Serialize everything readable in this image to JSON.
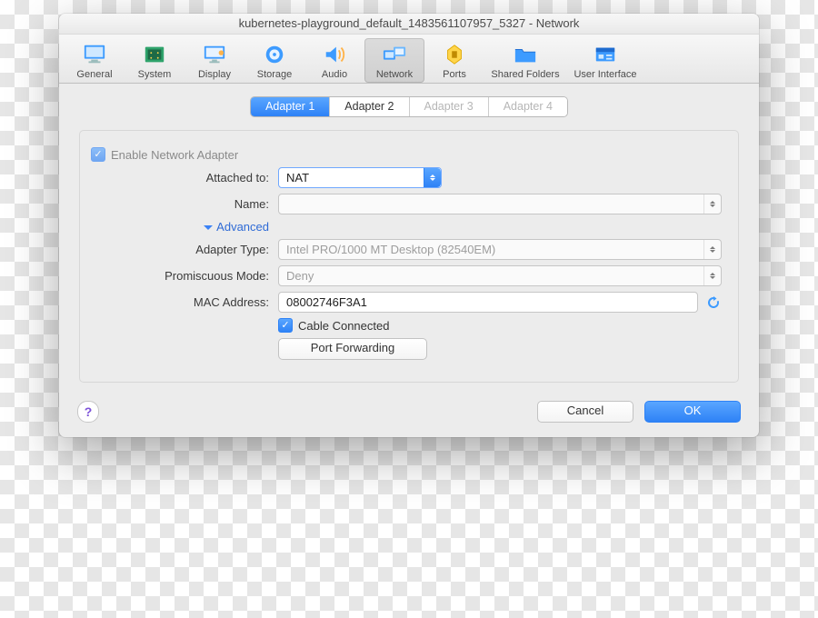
{
  "window": {
    "title": "kubernetes-playground_default_1483561107957_5327 - Network"
  },
  "toolbar": {
    "items": [
      {
        "id": "general",
        "label": "General"
      },
      {
        "id": "system",
        "label": "System"
      },
      {
        "id": "display",
        "label": "Display"
      },
      {
        "id": "storage",
        "label": "Storage"
      },
      {
        "id": "audio",
        "label": "Audio"
      },
      {
        "id": "network",
        "label": "Network"
      },
      {
        "id": "ports",
        "label": "Ports"
      },
      {
        "id": "shared",
        "label": "Shared Folders"
      },
      {
        "id": "ui",
        "label": "User Interface"
      }
    ]
  },
  "tabs": {
    "items": [
      "Adapter 1",
      "Adapter 2",
      "Adapter 3",
      "Adapter 4"
    ],
    "active_index": 0,
    "enabled": [
      true,
      true,
      false,
      false
    ]
  },
  "form": {
    "enable_label": "Enable Network Adapter",
    "enable_checked": true,
    "attached_label": "Attached to:",
    "attached_value": "NAT",
    "name_label": "Name:",
    "name_value": "",
    "advanced_label": "Advanced",
    "adapter_type_label": "Adapter Type:",
    "adapter_type_value": "Intel PRO/1000 MT Desktop (82540EM)",
    "promiscuous_label": "Promiscuous Mode:",
    "promiscuous_value": "Deny",
    "mac_label": "MAC Address:",
    "mac_value": "08002746F3A1",
    "cable_label": "Cable Connected",
    "cable_checked": true,
    "port_forwarding_label": "Port Forwarding"
  },
  "footer": {
    "help": "?",
    "cancel": "Cancel",
    "ok": "OK"
  },
  "colors": {
    "accent": "#2e82f6"
  }
}
